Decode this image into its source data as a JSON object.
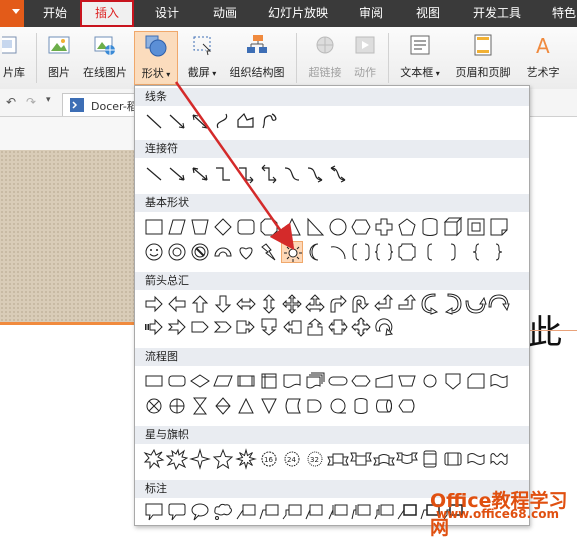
{
  "menubar": {
    "tabs": [
      "开始",
      "插入",
      "设计",
      "动画",
      "幻灯片放映",
      "审阅",
      "视图",
      "开发工具",
      "特色"
    ],
    "active_tab": "插入"
  },
  "ribbon": {
    "buttons": {
      "lib": "片库",
      "picture": "图片",
      "online_picture": "在线图片",
      "shapes": "形状",
      "screenshot": "截屏",
      "org_chart": "组织结构图",
      "hyperlink": "超链接",
      "action": "动作",
      "textbox": "文本框",
      "header_footer": "页眉和页脚",
      "wordart": "艺术字"
    }
  },
  "quickbar": {
    "doc_tab": "Docer-稻"
  },
  "canvas_text": "此",
  "shapes_panel": {
    "sections": [
      "线条",
      "连接符",
      "基本形状",
      "箭头总汇",
      "流程图",
      "星与旗帜",
      "标注"
    ]
  },
  "watermark": {
    "line1": "Office教程学习网",
    "line2": "www.office68.com"
  },
  "colors": {
    "accent": "#e35b19",
    "highlight": "#c8141e",
    "selected_fill": "#fdd8b8"
  }
}
